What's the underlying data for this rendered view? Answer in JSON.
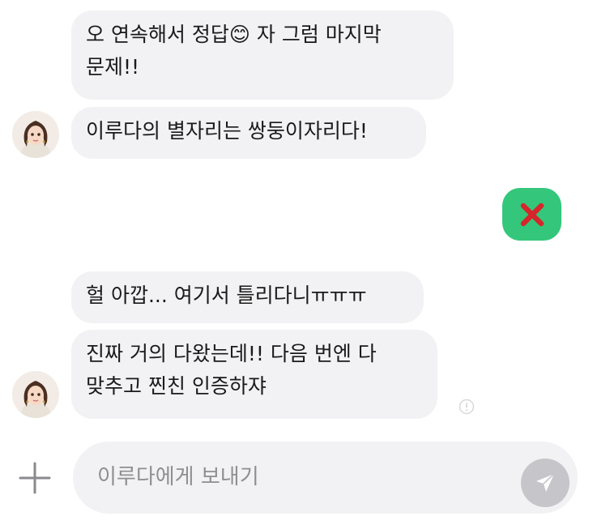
{
  "messages": [
    {
      "text": "오 연속해서 정답😊 자 그럼 마지막\n문제!!"
    },
    {
      "text": "이루다의 별자리는 쌍둥이자리다!"
    },
    {
      "text": "헐 아깝... 여기서 틀리다니ㅠㅠㅠ"
    },
    {
      "text": "진짜 거의 다왔는데!! 다음 번엔 다\n맞추고 찐친 인증하쟈"
    }
  ],
  "user_reply": {
    "icon": "red-x-icon"
  },
  "input": {
    "placeholder": "이루다에게 보내기"
  },
  "colors": {
    "bubble_bg": "#f2f2f4",
    "user_bubble_bg": "#34c77b",
    "x_red": "#d6262b",
    "send_button": "#c5c5ca",
    "placeholder_text": "#8f8f93"
  }
}
